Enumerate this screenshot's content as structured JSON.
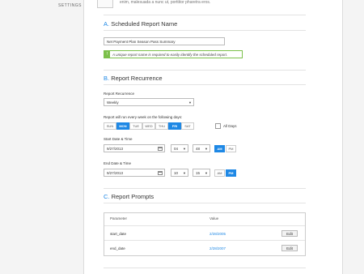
{
  "nav": {
    "settings": "SETTINGS"
  },
  "intro_text": "enim, malesuada a nunc ut, porttitor pharetra eros.",
  "section_a": {
    "letter": "A.",
    "title": "Scheduled Report Name",
    "input_value": "Net Payment Plan Season Pass Summary",
    "hint_badge": "!",
    "hint_text": "A unique report name is required to easily identify the scheduled report."
  },
  "section_b": {
    "letter": "B.",
    "title": "Report Recurrence",
    "recurrence_label": "Report Recurrence",
    "recurrence_value": "Weekly",
    "days_label": "Report will run every week on the following days:",
    "days": [
      {
        "label": "SUN",
        "active": false
      },
      {
        "label": "MON",
        "active": true
      },
      {
        "label": "TUE",
        "active": false
      },
      {
        "label": "WED",
        "active": false
      },
      {
        "label": "THU",
        "active": false
      },
      {
        "label": "FRI",
        "active": true
      },
      {
        "label": "SAT",
        "active": false
      }
    ],
    "all_days_label": "All Days",
    "start_label": "Start Date & Time",
    "start_date": "9/27/2013",
    "start_hour": "04",
    "start_minute": "48",
    "start_am": "AM",
    "start_pm": "PM",
    "start_period": "AM",
    "end_label": "End Date & Time",
    "end_date": "9/27/2013",
    "end_hour": "10",
    "end_minute": "15",
    "end_am": "AM",
    "end_pm": "PM",
    "end_period": "PM"
  },
  "section_c": {
    "letter": "C.",
    "title": "Report Prompts",
    "col_parameter": "Parameter",
    "col_value": "Value",
    "rows": [
      {
        "parameter": "start_date",
        "value": "2/28/2005",
        "action": "Edit"
      },
      {
        "parameter": "end_date",
        "value": "2/28/2007",
        "action": "Edit"
      }
    ]
  },
  "colors": {
    "accent": "#1e88e5",
    "hint": "#7cc04b"
  },
  "icons": {
    "caret": "chevron-down-icon",
    "calendar": "calendar-icon"
  }
}
